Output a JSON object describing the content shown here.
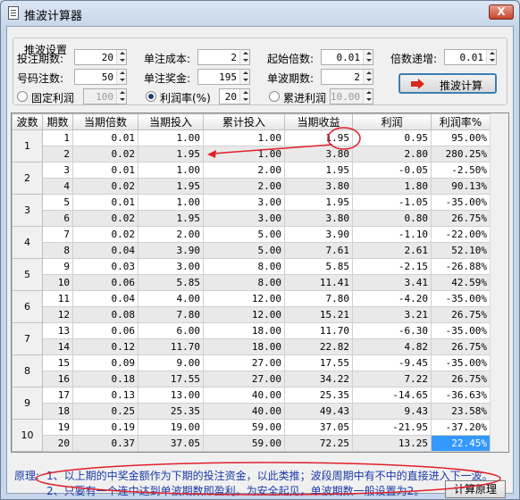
{
  "window": {
    "title": "推波计算器",
    "close_label": "X"
  },
  "settings": {
    "group_title": "推波设置",
    "periods_label": "投注期数:",
    "periods_value": "20",
    "unit_cost_label": "单注成本:",
    "unit_cost_value": "2",
    "start_multiplier_label": "起始倍数:",
    "start_multiplier_value": "0.01",
    "multiplier_increment_label": "倍数递增:",
    "multiplier_increment_value": "0.01",
    "numbers_label": "号码注数:",
    "numbers_value": "50",
    "unit_prize_label": "单注奖金:",
    "unit_prize_value": "195",
    "wave_periods_label": "单波期数:",
    "wave_periods_value": "2",
    "fixed_profit_label": "固定利润",
    "fixed_profit_value": "100",
    "profit_rate_label": "利润率(%)",
    "profit_rate_value": "20",
    "cumulative_profit_label": "累进利润",
    "cumulative_profit_value": "10.00",
    "selected_mode": "profit_rate",
    "calculate_button": "推波计算"
  },
  "table": {
    "headers": [
      "波数",
      "期数",
      "当期倍数",
      "当期投入",
      "累计投入",
      "当期收益",
      "利润",
      "利润率%"
    ],
    "waves": [
      "1",
      "2",
      "3",
      "4",
      "5",
      "6",
      "7",
      "8",
      "9",
      "10"
    ],
    "rows": [
      {
        "period": "1",
        "mult": "0.01",
        "inv": "1.00",
        "cum": "1.00",
        "ret": "1.95",
        "profit": "0.95",
        "rate": "95.00%"
      },
      {
        "period": "2",
        "mult": "0.02",
        "inv": "1.95",
        "cum": "1.00",
        "ret": "3.80",
        "profit": "2.80",
        "rate": "280.25%"
      },
      {
        "period": "3",
        "mult": "0.01",
        "inv": "1.00",
        "cum": "2.00",
        "ret": "1.95",
        "profit": "-0.05",
        "rate": "-2.50%"
      },
      {
        "period": "4",
        "mult": "0.02",
        "inv": "1.95",
        "cum": "2.00",
        "ret": "3.80",
        "profit": "1.80",
        "rate": "90.13%"
      },
      {
        "period": "5",
        "mult": "0.01",
        "inv": "1.00",
        "cum": "3.00",
        "ret": "1.95",
        "profit": "-1.05",
        "rate": "-35.00%"
      },
      {
        "period": "6",
        "mult": "0.02",
        "inv": "1.95",
        "cum": "3.00",
        "ret": "3.80",
        "profit": "0.80",
        "rate": "26.75%"
      },
      {
        "period": "7",
        "mult": "0.02",
        "inv": "2.00",
        "cum": "5.00",
        "ret": "3.90",
        "profit": "-1.10",
        "rate": "-22.00%"
      },
      {
        "period": "8",
        "mult": "0.04",
        "inv": "3.90",
        "cum": "5.00",
        "ret": "7.61",
        "profit": "2.61",
        "rate": "52.10%"
      },
      {
        "period": "9",
        "mult": "0.03",
        "inv": "3.00",
        "cum": "8.00",
        "ret": "5.85",
        "profit": "-2.15",
        "rate": "-26.88%"
      },
      {
        "period": "10",
        "mult": "0.06",
        "inv": "5.85",
        "cum": "8.00",
        "ret": "11.41",
        "profit": "3.41",
        "rate": "42.59%"
      },
      {
        "period": "11",
        "mult": "0.04",
        "inv": "4.00",
        "cum": "12.00",
        "ret": "7.80",
        "profit": "-4.20",
        "rate": "-35.00%"
      },
      {
        "period": "12",
        "mult": "0.08",
        "inv": "7.80",
        "cum": "12.00",
        "ret": "15.21",
        "profit": "3.21",
        "rate": "26.75%"
      },
      {
        "period": "13",
        "mult": "0.06",
        "inv": "6.00",
        "cum": "18.00",
        "ret": "11.70",
        "profit": "-6.30",
        "rate": "-35.00%"
      },
      {
        "period": "14",
        "mult": "0.12",
        "inv": "11.70",
        "cum": "18.00",
        "ret": "22.82",
        "profit": "4.82",
        "rate": "26.75%"
      },
      {
        "period": "15",
        "mult": "0.09",
        "inv": "9.00",
        "cum": "27.00",
        "ret": "17.55",
        "profit": "-9.45",
        "rate": "-35.00%"
      },
      {
        "period": "16",
        "mult": "0.18",
        "inv": "17.55",
        "cum": "27.00",
        "ret": "34.22",
        "profit": "7.22",
        "rate": "26.75%"
      },
      {
        "period": "17",
        "mult": "0.13",
        "inv": "13.00",
        "cum": "40.00",
        "ret": "25.35",
        "profit": "-14.65",
        "rate": "-36.63%"
      },
      {
        "period": "18",
        "mult": "0.25",
        "inv": "25.35",
        "cum": "40.00",
        "ret": "49.43",
        "profit": "9.43",
        "rate": "23.58%"
      },
      {
        "period": "19",
        "mult": "0.19",
        "inv": "19.00",
        "cum": "59.00",
        "ret": "37.05",
        "profit": "-21.95",
        "rate": "-37.20%"
      },
      {
        "period": "20",
        "mult": "0.37",
        "inv": "37.05",
        "cum": "59.00",
        "ret": "72.25",
        "profit": "13.25",
        "rate": "22.45%"
      }
    ]
  },
  "principle": {
    "label": "原理:",
    "line1": "1、以上期的中奖金额作为下期的投注资金，以此类推；波段周期中有不中的直接进入下一波。",
    "line2": "2、只要有一个连中达到单波期数即盈利。为安全起见，单波期数一般设置为2。",
    "button": "计算原理"
  },
  "colors": {
    "annotation": "#e0202a",
    "selection": "#3399ff",
    "principle_text": "#1a3aa8"
  }
}
